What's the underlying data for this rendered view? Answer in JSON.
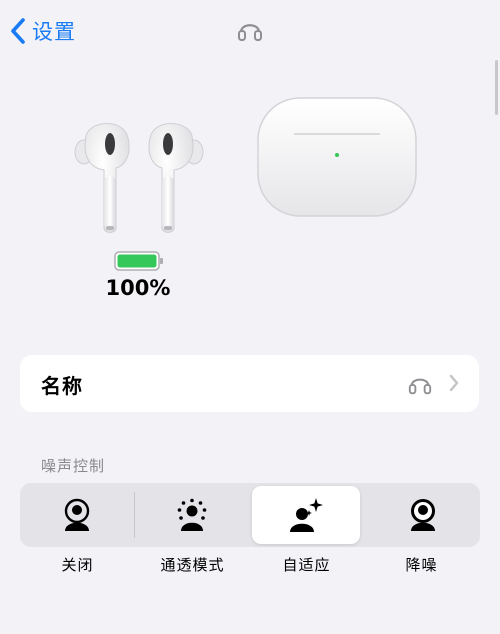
{
  "nav": {
    "back_label": "设置",
    "accent_color": "#1a7cf5",
    "back_icon": "chevron-left-icon",
    "title_icon": "airpods-icon"
  },
  "device": {
    "buds_image": "airpods-pro-earbuds",
    "case_image": "airpods-pro-case",
    "battery": {
      "percent_text": "100%",
      "level": 1.0,
      "color": "#34c759"
    }
  },
  "name_row": {
    "label": "名称",
    "icon": "airpods-icon",
    "chevron": "chevron-right-icon"
  },
  "noise_control": {
    "section_title": "噪声控制",
    "options": [
      {
        "label": "关闭",
        "icon": "person-off-icon",
        "selected": false
      },
      {
        "label": "通透模式",
        "icon": "person-transparency-icon",
        "selected": false
      },
      {
        "label": "自适应",
        "icon": "person-adaptive-icon",
        "selected": true
      },
      {
        "label": "降噪",
        "icon": "person-noise-cancel-icon",
        "selected": false
      }
    ]
  }
}
